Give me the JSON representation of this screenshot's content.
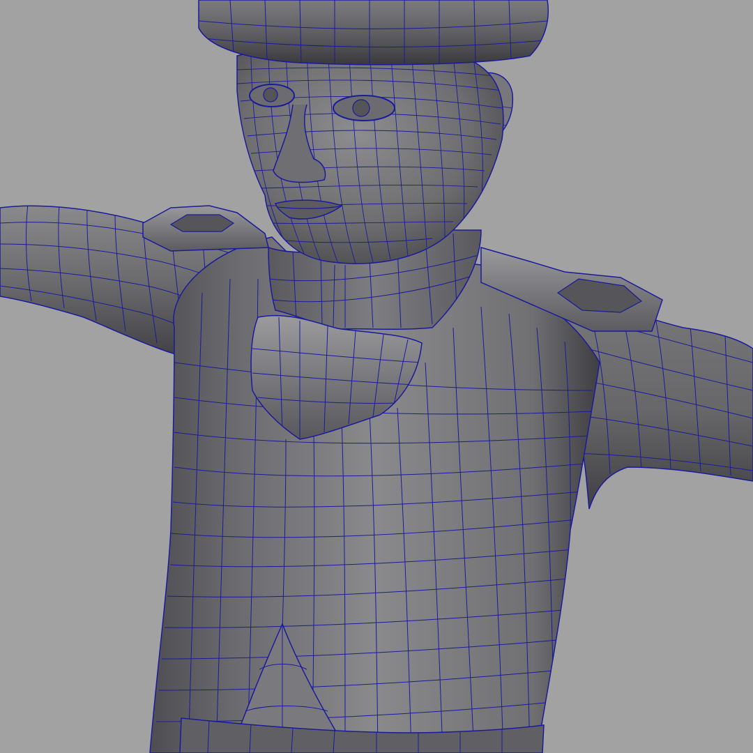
{
  "viewport": {
    "background_color": "#a2a2a2",
    "wire_color": "#1a1a9c",
    "shading": "smooth-shade-with-wireframe",
    "model": "male-character-uniform-tpose"
  },
  "visible_parts": [
    "hat",
    "head",
    "left-ear",
    "collar",
    "neck-flap",
    "left-epaulette",
    "right-epaulette",
    "left-arm",
    "right-arm",
    "torso",
    "coat-front-panel",
    "belt"
  ]
}
